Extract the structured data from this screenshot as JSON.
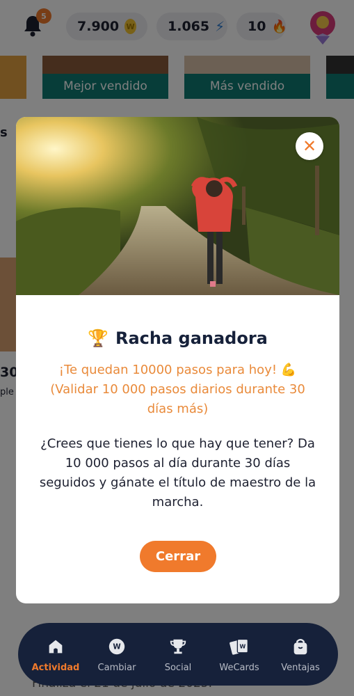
{
  "topbar": {
    "notification_count": "5",
    "coins": "7.900",
    "coin_symbol": "W",
    "energy": "1.065",
    "streak": "10"
  },
  "background": {
    "card_labels": [
      "Mejor vendido",
      "Más vendido"
    ],
    "left_peek_s": "s",
    "left_peek_number": "30",
    "left_peek_text": "ple",
    "bottom_text": "Finaliza el 21 de julio de 2025."
  },
  "modal": {
    "title": "Racha ganadora",
    "orange_line1": "¡Te quedan 10000 pasos para hoy! 💪",
    "orange_line2": "(Validar 10 000 pasos diarios durante 30 días más)",
    "description": "¿Crees que tienes lo que hay que tener? Da 10 000 pasos al día durante 30 días seguidos y gánate el título de maestro de la marcha.",
    "button_label": "Cerrar"
  },
  "nav": {
    "items": [
      {
        "label": "Actividad",
        "icon": "home-icon",
        "active": true
      },
      {
        "label": "Cambiar",
        "icon": "coin-icon",
        "active": false
      },
      {
        "label": "Social",
        "icon": "trophy-icon",
        "active": false
      },
      {
        "label": "WeCards",
        "icon": "cards-icon",
        "active": false
      },
      {
        "label": "Ventajas",
        "icon": "bag-icon",
        "active": false
      }
    ]
  },
  "colors": {
    "accent": "#f07a2c",
    "nav_bg": "#16213a",
    "teal": "#0f7a72"
  }
}
